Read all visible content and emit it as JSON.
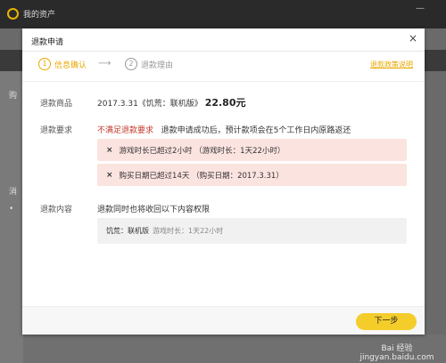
{
  "app": {
    "title": "我的资产",
    "minimize": "—",
    "side_label_1": "购",
    "side_label_2": "消",
    "side_bullet": "•"
  },
  "dialog": {
    "title": "退款申请",
    "close": "×",
    "steps": [
      {
        "num": "1",
        "label": "信息确认"
      },
      {
        "num": "2",
        "label": "退款理由"
      }
    ],
    "arrow": "⟶",
    "policy_link": "退款政策说明",
    "product": {
      "label": "退款商品",
      "date_name": "2017.3.31《饥荒：联机版》",
      "price": "22.80元"
    },
    "requirement": {
      "label": "退款要求",
      "status": "不满足退款要求",
      "note": "退款申请成功后，预计款项会在5个工作日内原路返还",
      "alerts": [
        "游戏时长已超过2小时  （游戏时长：1天22小时）",
        "购买日期已超过14天  （购买日期：2017.3.31）"
      ],
      "alert_icon": "×"
    },
    "content": {
      "label": "退款内容",
      "desc": "退款同时也将收回以下内容权限",
      "game": "饥荒：联机版",
      "playtime": "游戏时长：1天22小时"
    },
    "next_button": "下一步"
  },
  "watermark": "Bai 经验 jingyan.baidu.com"
}
